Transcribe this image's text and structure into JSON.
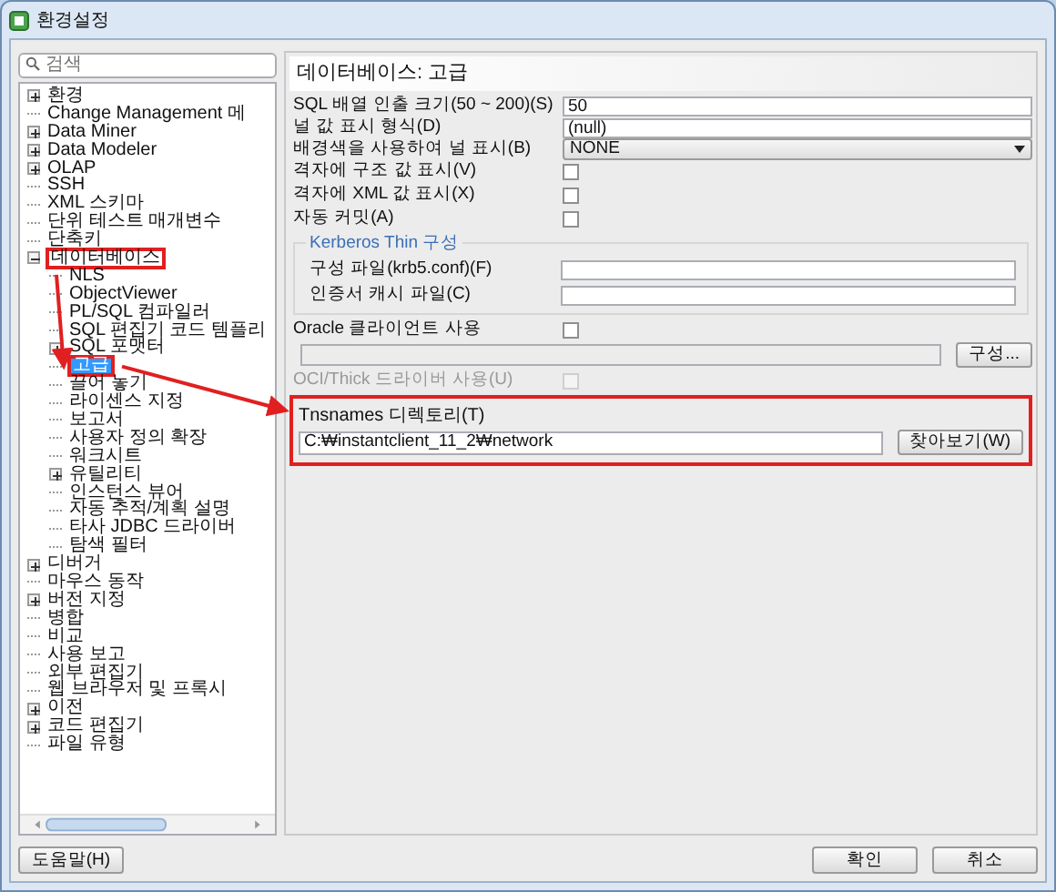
{
  "window": {
    "title": "환경설정"
  },
  "search": {
    "placeholder": "검색"
  },
  "tree": [
    {
      "label": "환경",
      "expanded": false
    },
    {
      "label": "Change Management 메"
    },
    {
      "label": "Data Miner",
      "expanded": false
    },
    {
      "label": "Data Modeler",
      "expanded": false
    },
    {
      "label": "OLAP",
      "expanded": false
    },
    {
      "label": "SSH"
    },
    {
      "label": "XML 스키마"
    },
    {
      "label": "단위 테스트 매개변수"
    },
    {
      "label": "단축키"
    },
    {
      "label": "데이터베이스",
      "expanded": true,
      "annotated": true,
      "children": [
        {
          "label": "NLS"
        },
        {
          "label": "ObjectViewer"
        },
        {
          "label": "PL/SQL 컴파일러"
        },
        {
          "label": "SQL 편집기 코드 템플리"
        },
        {
          "label": "SQL 포맷터",
          "expanded": false
        },
        {
          "label": "고급",
          "selected": true,
          "annotated": true
        },
        {
          "label": "끌어 놓기"
        },
        {
          "label": "라이센스 지정"
        },
        {
          "label": "보고서"
        },
        {
          "label": "사용자 정의 확장"
        },
        {
          "label": "워크시트"
        },
        {
          "label": "유틸리티",
          "expanded": false
        },
        {
          "label": "인스턴스 뷰어"
        },
        {
          "label": "자동 추적/계획 설명"
        },
        {
          "label": "타사 JDBC 드라이버"
        },
        {
          "label": "탐색 필터"
        }
      ]
    },
    {
      "label": "디버거",
      "expanded": false
    },
    {
      "label": "마우스 동작"
    },
    {
      "label": "버전 지정",
      "expanded": false
    },
    {
      "label": "병합"
    },
    {
      "label": "비교"
    },
    {
      "label": "사용 보고"
    },
    {
      "label": "외부 편집기"
    },
    {
      "label": "웹 브라우저 및 프록시"
    },
    {
      "label": "이전",
      "expanded": false
    },
    {
      "label": "코드 편집기",
      "expanded": false
    },
    {
      "label": "파일 유형"
    }
  ],
  "panel": {
    "title": "데이터베이스: 고급",
    "rows": [
      {
        "kind": "text",
        "label": "SQL 배열 인출 크기(50 ~ 200)(S)",
        "value": "50"
      },
      {
        "kind": "text",
        "label": "널 값 표시 형식(D)",
        "value": "(null)"
      },
      {
        "kind": "select",
        "label": "배경색을 사용하여 널 표시(B)",
        "value": "NONE"
      },
      {
        "kind": "checkbox",
        "label": "격자에 구조 값 표시(V)",
        "checked": false,
        "disabled": false
      },
      {
        "kind": "checkbox",
        "label": "격자에 XML 값 표시(X)",
        "checked": false,
        "disabled": false
      },
      {
        "kind": "checkbox",
        "label": "자동 커밋(A)",
        "checked": false,
        "disabled": false
      },
      {
        "kind": "group",
        "title": "Kerberos Thin 구성",
        "fields": [
          {
            "label": "구성 파일(krb5.conf)(F)"
          },
          {
            "label": "인증서 캐시 파일(C)"
          }
        ]
      },
      {
        "kind": "checkbox",
        "label": "Oracle 클라이언트 사용",
        "checked": false,
        "disabled": false
      },
      {
        "kind": "path",
        "button": "구성...",
        "disabled": true
      },
      {
        "kind": "checkbox",
        "label": "OCI/Thick 드라이버 사용(U)",
        "checked": false,
        "disabled": true
      },
      {
        "kind": "browse",
        "label": "Tnsnames 디렉토리(T)",
        "value": "C:₩instantclient_11_2₩network",
        "button": "찾아보기(W)",
        "annotated": true
      }
    ]
  },
  "buttons": {
    "help": "도움말(H)",
    "ok": "확인",
    "cancel": "취소"
  }
}
